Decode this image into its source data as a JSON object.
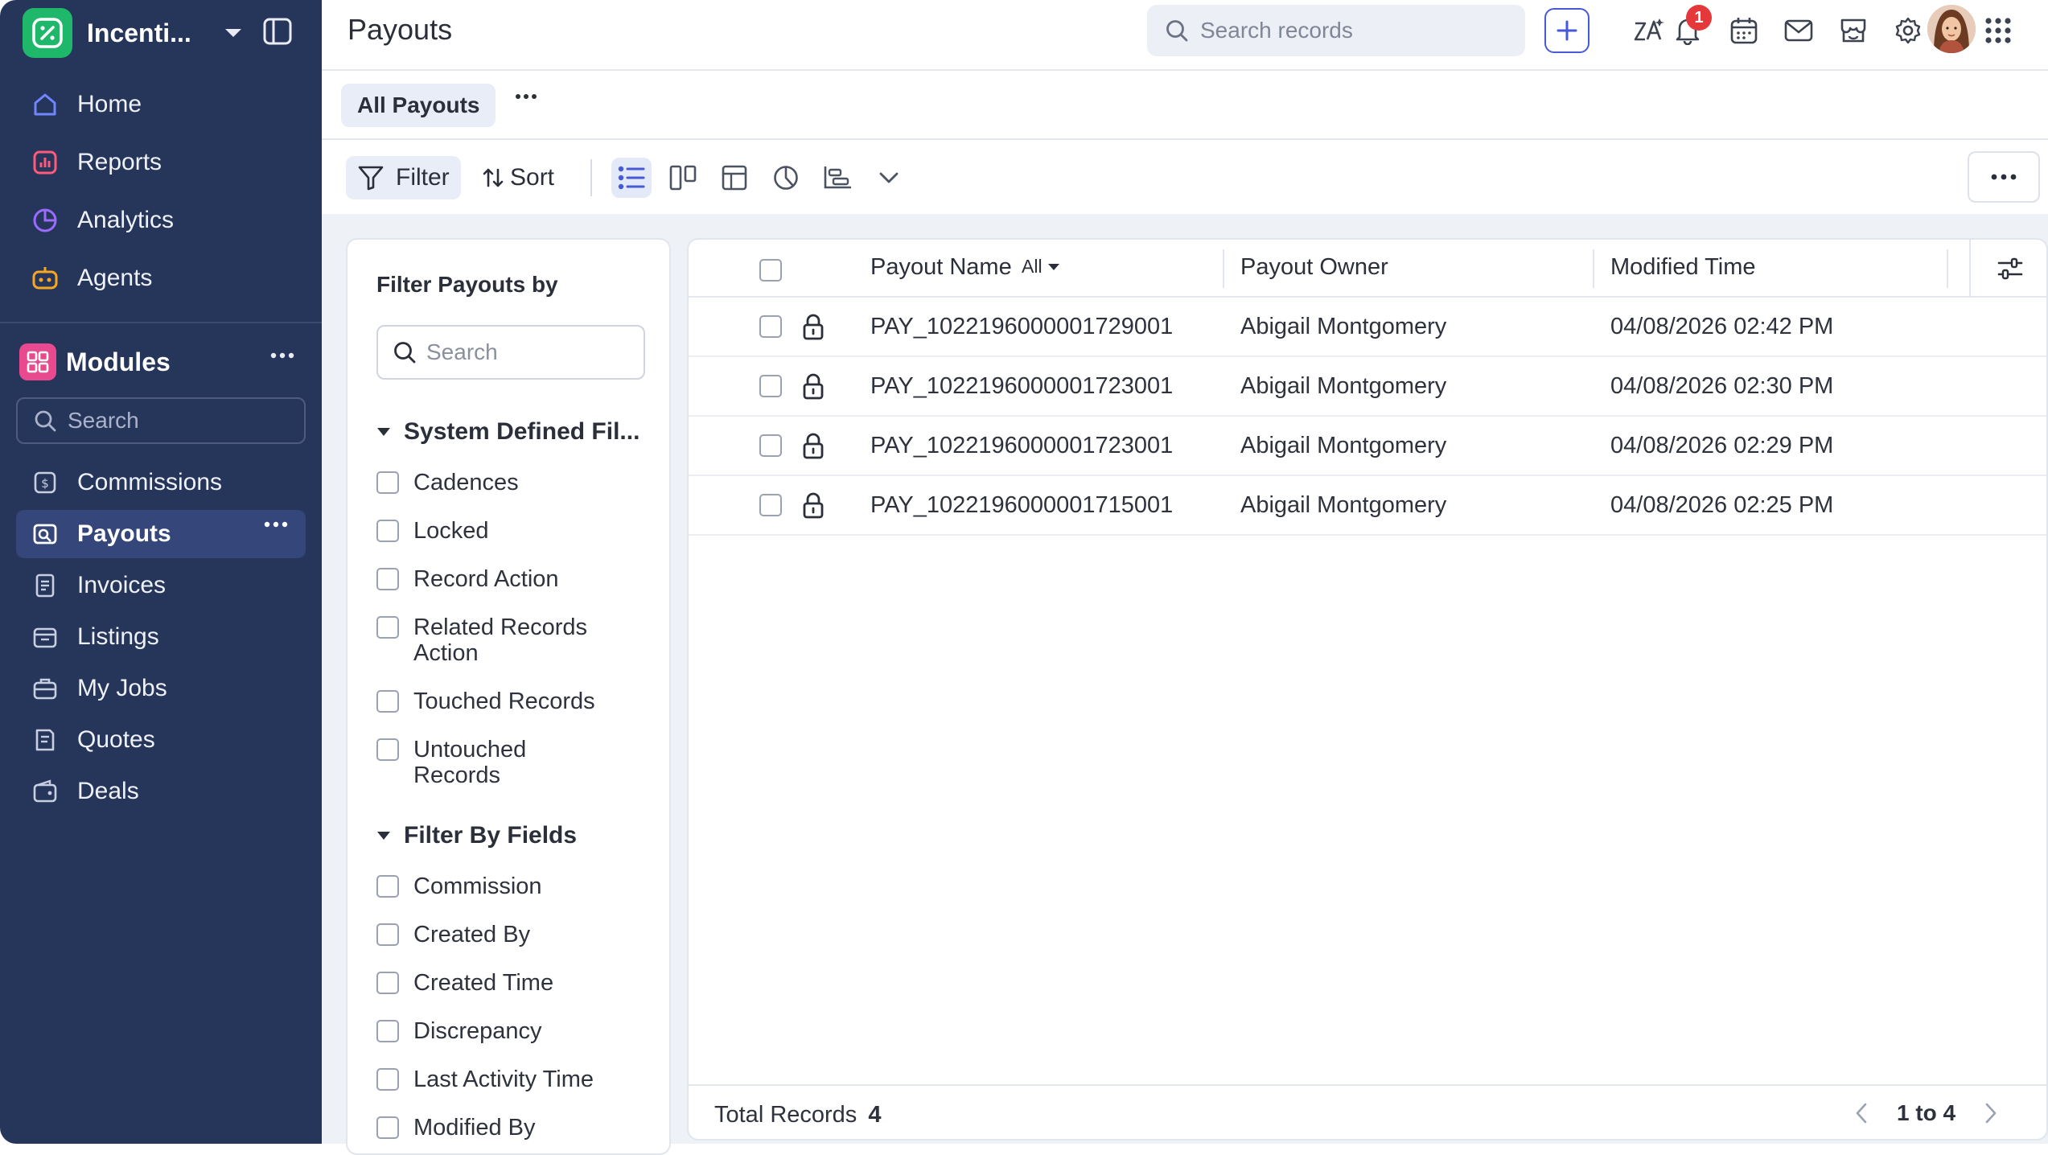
{
  "app": {
    "name": "Incenti...",
    "logo_icon": "percent-badge-icon",
    "brand_color": "#1fb86a"
  },
  "sidebar": {
    "nav": [
      {
        "label": "Home",
        "icon": "home-icon"
      },
      {
        "label": "Reports",
        "icon": "reports-icon"
      },
      {
        "label": "Analytics",
        "icon": "analytics-icon"
      },
      {
        "label": "Agents",
        "icon": "agent-robot-icon"
      }
    ],
    "modules_title": "Modules",
    "search_placeholder": "Search",
    "modules": [
      {
        "label": "Commissions",
        "icon": "commission-icon",
        "active": false
      },
      {
        "label": "Payouts",
        "icon": "payout-icon",
        "active": true
      },
      {
        "label": "Invoices",
        "icon": "invoice-icon",
        "active": false
      },
      {
        "label": "Listings",
        "icon": "listing-icon",
        "active": false
      },
      {
        "label": "My Jobs",
        "icon": "briefcase-icon",
        "active": false
      },
      {
        "label": "Quotes",
        "icon": "quote-icon",
        "active": false
      },
      {
        "label": "Deals",
        "icon": "wallet-icon",
        "active": false
      }
    ]
  },
  "header": {
    "title": "Payouts",
    "search_placeholder": "Search records",
    "notification_count": "1",
    "accent": "#4759d6"
  },
  "views": {
    "active_tab": "All Payouts"
  },
  "toolbar": {
    "filter_label": "Filter",
    "sort_label": "Sort"
  },
  "filter_panel": {
    "title": "Filter Payouts by",
    "search_placeholder": "Search",
    "system_section": "System Defined Fil...",
    "system_options": [
      "Cadences",
      "Locked",
      "Record Action",
      "Related Records Action",
      "Touched Records",
      "Untouched Records"
    ],
    "fields_section": "Filter By Fields",
    "field_options": [
      "Commission",
      "Created By",
      "Created Time",
      "Discrepancy",
      "Last Activity Time",
      "Modified By"
    ]
  },
  "table": {
    "columns": [
      "Payout Name",
      "Payout Owner",
      "Modified Time"
    ],
    "name_filter": "All",
    "rows": [
      {
        "name": "PAY_1022196000001729001",
        "owner": "Abigail Montgomery",
        "modified": "04/08/2026 02:42 PM"
      },
      {
        "name": "PAY_1022196000001723001",
        "owner": "Abigail Montgomery",
        "modified": "04/08/2026 02:30 PM"
      },
      {
        "name": "PAY_1022196000001723001",
        "owner": "Abigail Montgomery",
        "modified": "04/08/2026 02:29 PM"
      },
      {
        "name": "PAY_1022196000001715001",
        "owner": "Abigail Montgomery",
        "modified": "04/08/2026 02:25 PM"
      }
    ],
    "total_label": "Total Records",
    "total_value": "4",
    "page_range": "1 to 4"
  }
}
